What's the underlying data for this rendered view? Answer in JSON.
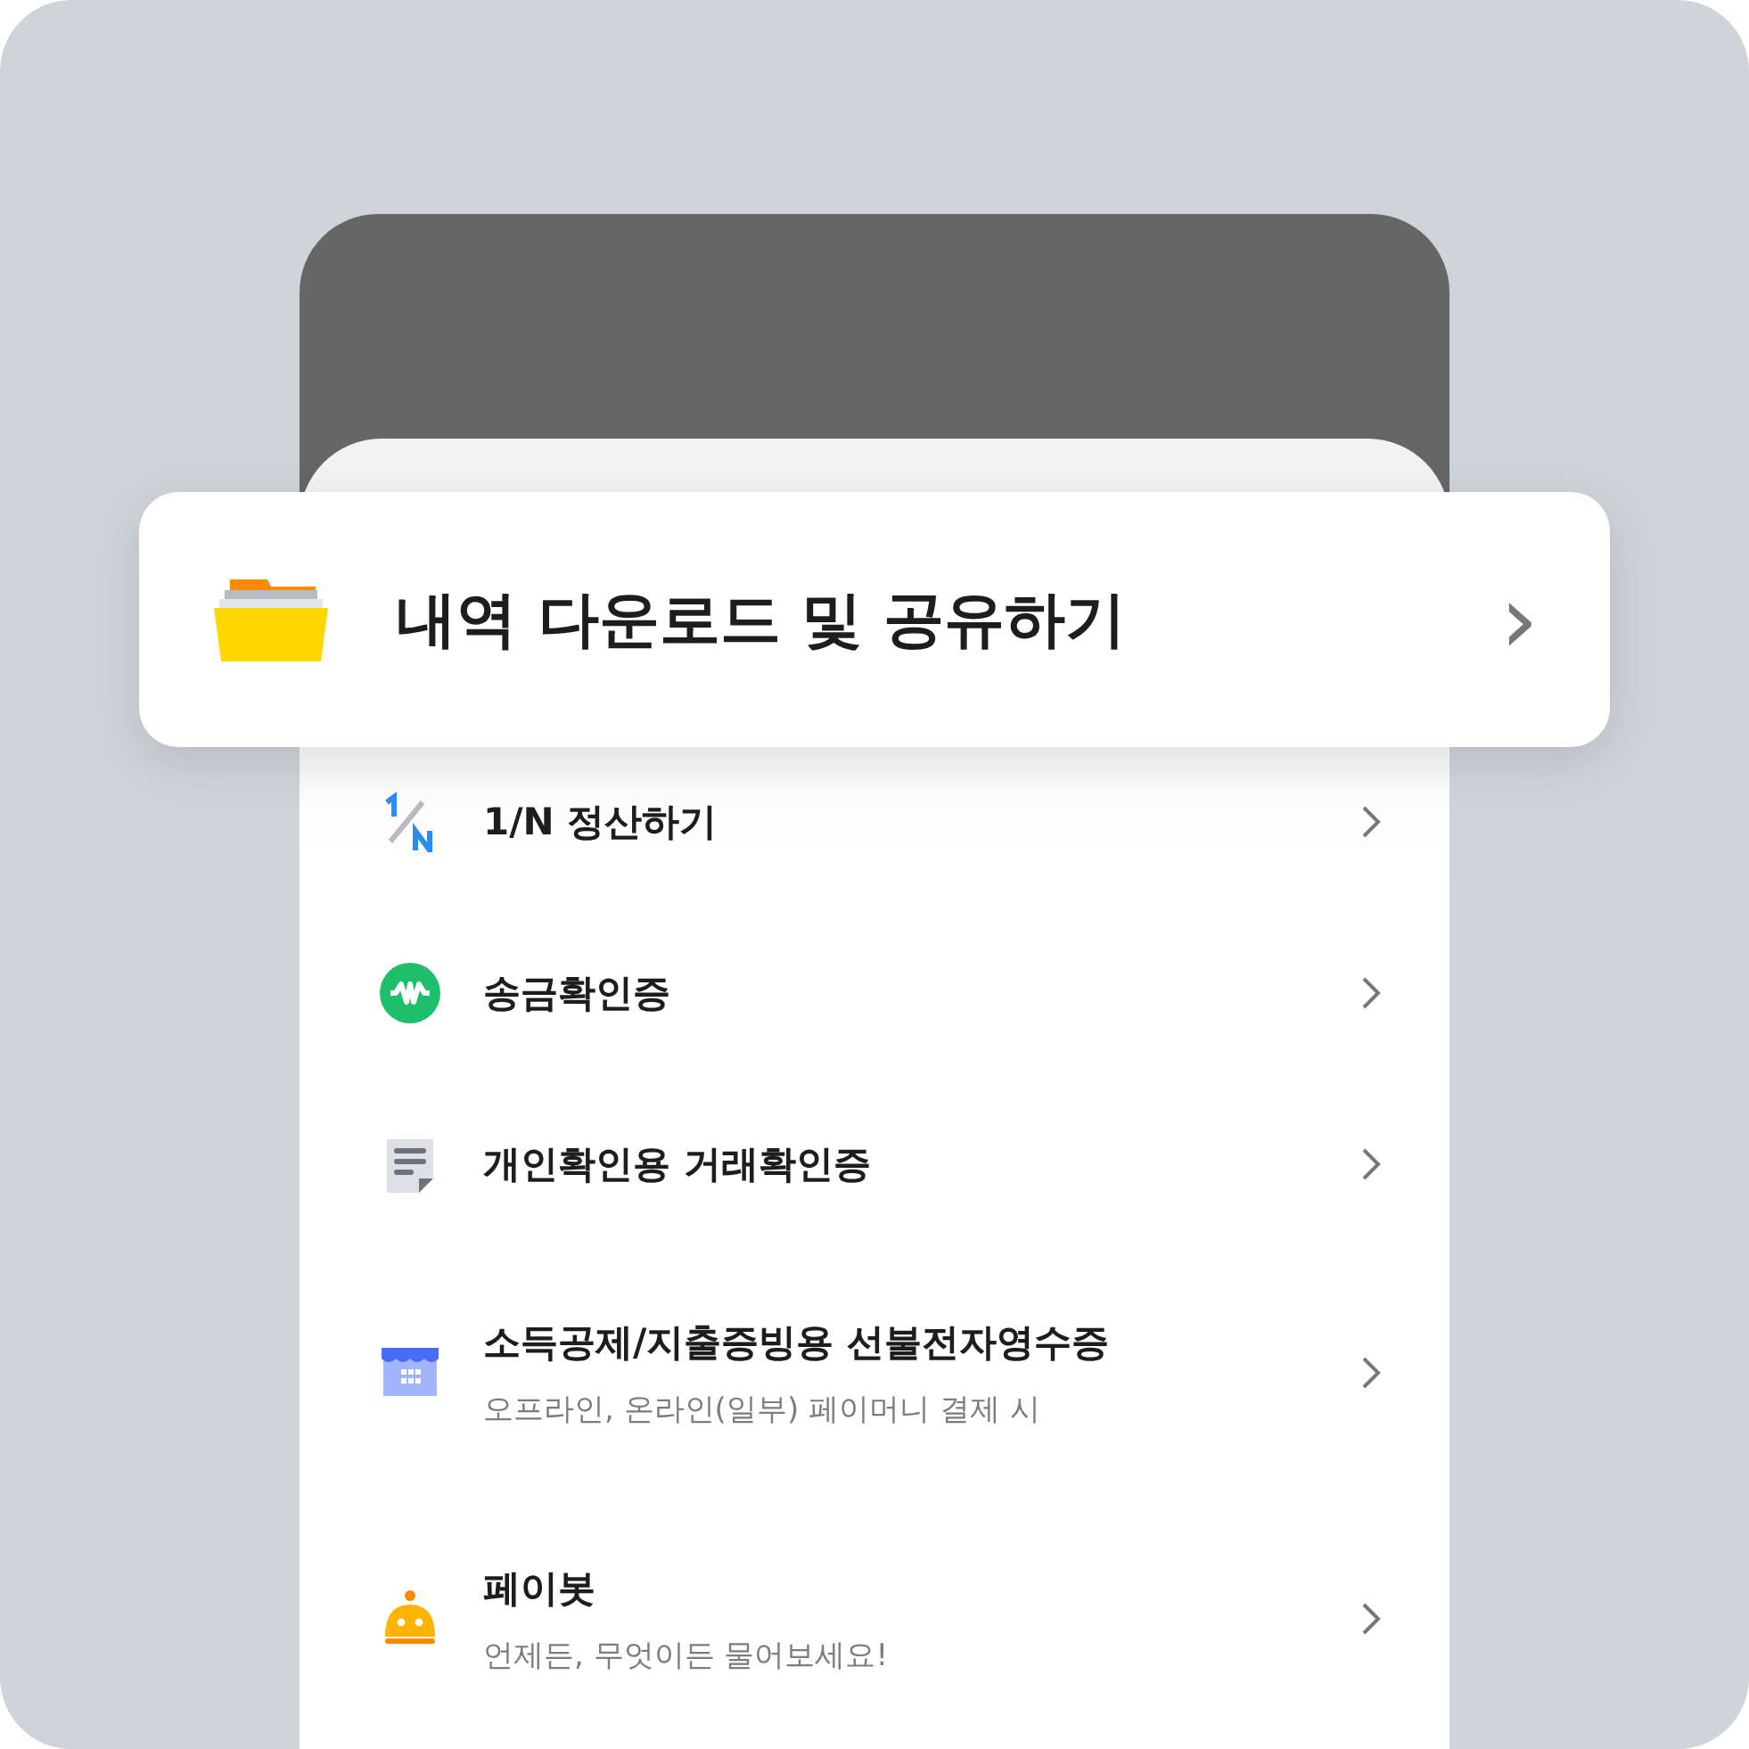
{
  "featured": {
    "title": "내역 다운로드 및 공유하기",
    "chevron": "›"
  },
  "menu": [
    {
      "kind": "fraction",
      "title": "1/N 정산하기"
    },
    {
      "kind": "won",
      "title": "송금확인증"
    },
    {
      "kind": "document",
      "title": "개인확인용 거래확인증"
    },
    {
      "kind": "store",
      "title": "소득공제/지출증빙용 선불전자영수증",
      "subtitle": "오프라인, 온라인(일부) 페이머니 결제 시"
    },
    {
      "kind": "robot",
      "title": "페이봇",
      "subtitle": "언제든, 무엇이든 물어보세요!"
    }
  ]
}
